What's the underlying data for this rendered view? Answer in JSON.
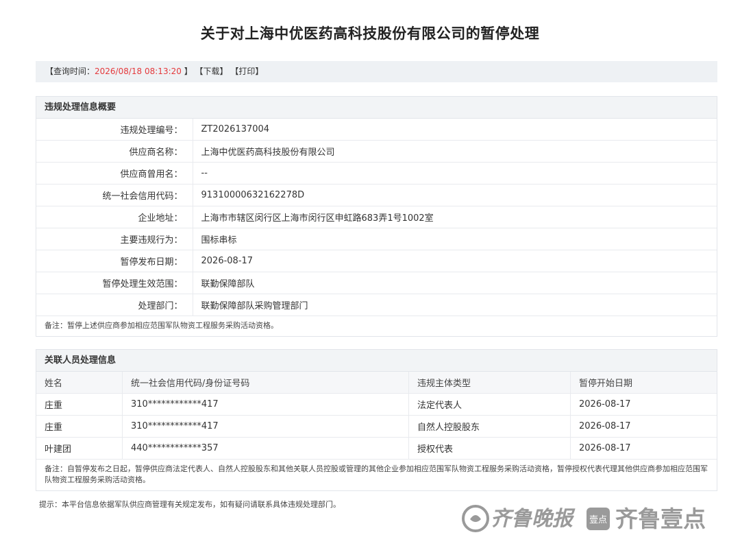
{
  "page": {
    "title": "关于对上海中优医药高科技股份有限公司的暂停处理"
  },
  "query_bar": {
    "time_prefix": "【查询时间：",
    "time_value": "2026/08/18 08:13:20",
    "time_suffix": " 】",
    "download_label": "【下载】",
    "print_label": "【打印】"
  },
  "summary": {
    "heading": "违规处理信息概要",
    "rows": [
      {
        "key": "违规处理编号：",
        "value": "ZT2026137004"
      },
      {
        "key": "供应商名称：",
        "value": "上海中优医药高科技股份有限公司"
      },
      {
        "key": "供应商曾用名：",
        "value": "--"
      },
      {
        "key": "统一社会信用代码：",
        "value": "91310000632162278D"
      },
      {
        "key": "企业地址：",
        "value": "上海市市辖区闵行区上海市闵行区申虹路683弄1号1002室"
      },
      {
        "key": "主要违规行为：",
        "value": "围标串标"
      },
      {
        "key": "暂停发布日期：",
        "value": "2026-08-17"
      },
      {
        "key": "暂停处理生效范围：",
        "value": "联勤保障部队"
      },
      {
        "key": "处理部门：",
        "value": "联勤保障部队采购管理部门"
      }
    ],
    "note": "备注：暂停上述供应商参加相应范围军队物资工程服务采购活动资格。"
  },
  "related": {
    "heading": "关联人员处理信息",
    "columns": [
      "姓名",
      "统一社会信用代码/身份证号码",
      "违规主体类型",
      "暂停开始日期"
    ],
    "rows": [
      [
        "庄重",
        "310************417",
        "法定代表人",
        "2026-08-17"
      ],
      [
        "庄重",
        "310************417",
        "自然人控股股东",
        "2026-08-17"
      ],
      [
        "叶建团",
        "440************357",
        "授权代表",
        "2026-08-17"
      ]
    ],
    "note": "备注：自暂停发布之日起，暂停供应商法定代表人、自然人控股股东和其他关联人员控股或管理的其他企业参加相应范围军队物资工程服务采购活动资格，暂停授权代表代理其他供应商参加相应范围军队物资工程服务采购活动资格。"
  },
  "tip": "提示：本平台信息依据军队供应商管理有关规定发布，如有疑问请联系具体违规处理部门。",
  "watermark": {
    "left_text": "齐鲁晚报",
    "badge_text": "壹点",
    "right_text": "齐鲁壹点",
    "color": "#9a9a9a"
  }
}
